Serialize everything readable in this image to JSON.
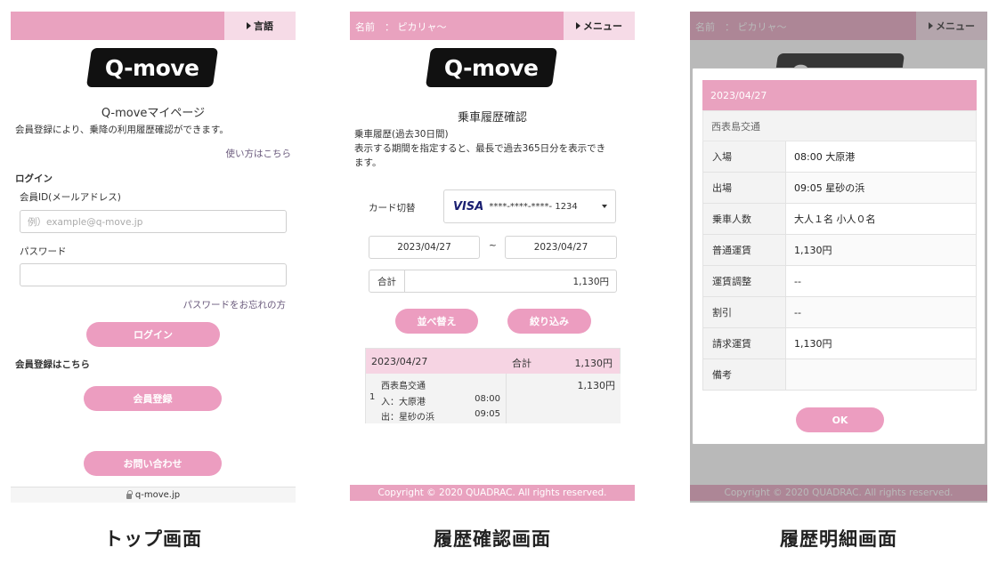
{
  "screen1": {
    "lang_button": "言語",
    "logo": "Q-move",
    "title": "Q-moveマイページ",
    "description": "会員登録により、乗降の利用履歴確認ができます。",
    "howto_link": "使い方はこちら",
    "login_heading": "ログイン",
    "member_id_label": "会員ID(メールアドレス)",
    "member_id_placeholder": "例）example@q-move.jp",
    "password_label": "パスワード",
    "forgot_link": "パスワードをお忘れの方",
    "login_button": "ログイン",
    "register_heading": "会員登録はこちら",
    "register_button": "会員登録",
    "contact_button": "お問い合わせ",
    "footer_url": "q-move.jp",
    "caption": "トップ画面"
  },
  "screen2": {
    "name_label": "名前　：",
    "name_value": "ピカリャ〜",
    "menu_button": "メニュー",
    "logo": "Q-move",
    "title": "乗車履歴確認",
    "history_note": "乗車履歴(過去30日間)",
    "period_note_1": "表示する期間を指定すると、最長で過去365日分を表示でき",
    "period_note_2": "ます。",
    "card_label": "カード切替",
    "card_brand": "VISA",
    "card_number": "****-****-****- 1234",
    "date_from": "2023/04/27",
    "date_sep": "~",
    "date_to": "2023/04/27",
    "total_label": "合計",
    "total_value": "1,130円",
    "sort_button": "並べ替え",
    "filter_button": "絞り込み",
    "result_date": "2023/04/27",
    "result_total_label": "合計",
    "result_total_value": "1,130円",
    "row_index": "1",
    "row_company": "西表島交通",
    "row_in": "入：大原港",
    "row_in_time": "08:00",
    "row_out": "出：星砂の浜",
    "row_out_time": "09:05",
    "row_fare": "1,130円",
    "footer": "Copyright © 2020 QUADRAC. All rights reserved.",
    "caption": "履歴確認画面"
  },
  "screen3": {
    "name_label": "名前　：",
    "name_value": "ピカリャ〜",
    "menu_button": "メニュー",
    "modal_date": "2023/04/27",
    "modal_company": "西表島交通",
    "rows": [
      {
        "k": "入場",
        "v": "08:00 大原港"
      },
      {
        "k": "出場",
        "v": "09:05 星砂の浜"
      },
      {
        "k": "乗車人数",
        "v": "大人１名  小人０名"
      },
      {
        "k": "普通運賃",
        "v": "1,130円"
      },
      {
        "k": "運賃調整",
        "v": "--"
      },
      {
        "k": "割引",
        "v": "--"
      },
      {
        "k": "請求運賃",
        "v": "1,130円"
      },
      {
        "k": "備考",
        "v": ""
      }
    ],
    "ok_button": "OK",
    "footer": "Copyright © 2020 QUADRAC. All rights reserved.",
    "caption": "履歴明細画面"
  }
}
